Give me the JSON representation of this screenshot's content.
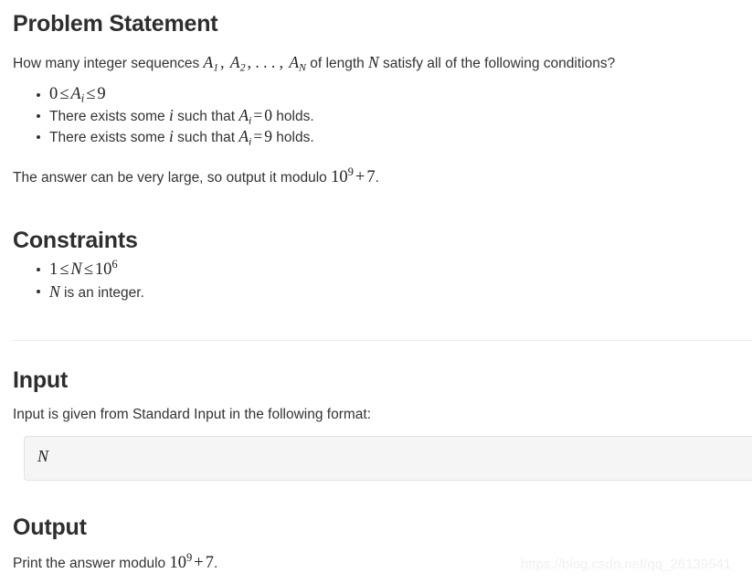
{
  "document": {
    "background_color": "#ffffff",
    "text_color": "#333333",
    "heading_color": "#2e2e2e"
  },
  "sections": {
    "problem_statement": {
      "heading": "Problem Statement",
      "intro": {
        "before_math": "How many integer sequences ",
        "seq_a1": "A",
        "seq_a1_sub": "1",
        "seq_sep1": ", ",
        "seq_a2": "A",
        "seq_a2_sub": "2",
        "seq_sep2": ", . . . , ",
        "seq_an": "A",
        "seq_an_sub": "N",
        "mid_text": " of length ",
        "n_var": "N",
        "after_math": " satisfy all of the following conditions?"
      },
      "conditions": [
        {
          "type": "math",
          "zero": "0",
          "le1": "≤",
          "a": "A",
          "a_sub": "i",
          "le2": "≤",
          "nine": "9"
        },
        {
          "type": "text",
          "lead": "There exists some ",
          "var_i": "i",
          "mid": " such that ",
          "a": "A",
          "a_sub": "i",
          "eq": "=",
          "val": "0",
          "tail": " holds."
        },
        {
          "type": "text",
          "lead": "There exists some ",
          "var_i": "i",
          "mid": " such that ",
          "a": "A",
          "a_sub": "i",
          "eq": "=",
          "val": "9",
          "tail": " holds."
        }
      ],
      "modulo_note": {
        "before": "The answer can be very large, so output it modulo ",
        "base": "10",
        "exponent": "9",
        "plus": "+",
        "addend": "7",
        "period": "."
      }
    },
    "constraints": {
      "heading": "Constraints",
      "items": [
        {
          "type": "math",
          "one": "1",
          "le1": "≤",
          "n": "N",
          "le2": "≤",
          "base": "10",
          "exponent": "6"
        },
        {
          "type": "text",
          "n": "N",
          "text": " is an integer."
        }
      ]
    },
    "input": {
      "heading": "Input",
      "description": "Input is given from Standard Input in the following format:",
      "format_block": {
        "value": "N",
        "background_color": "#f5f5f5",
        "border_color": "#e3e3e3"
      }
    },
    "output": {
      "heading": "Output",
      "description": {
        "before": "Print the answer modulo ",
        "base": "10",
        "exponent": "9",
        "plus": "+",
        "addend": "7",
        "period": "."
      }
    }
  },
  "watermark": {
    "text": "https://blog.csdn.net/qq_26139541",
    "color": "#f0f0f0"
  }
}
